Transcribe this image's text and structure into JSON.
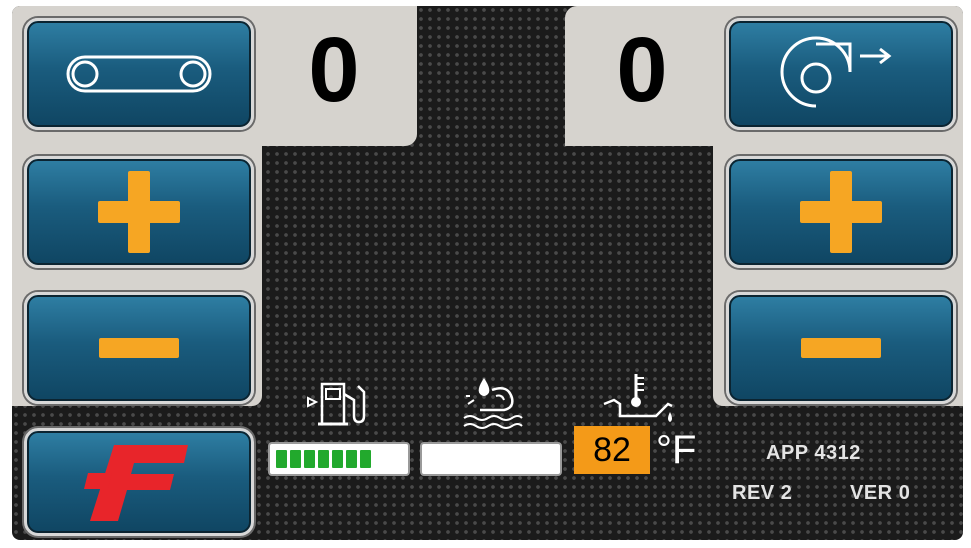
{
  "left": {
    "counter": "0",
    "buttons": {
      "plus_icon": "plus-icon",
      "minus_icon": "minus-icon",
      "top_icon": "conveyor-belt-icon",
      "logo": "brand-f-logo"
    }
  },
  "right": {
    "counter": "0",
    "buttons": {
      "plus_icon": "plus-icon",
      "minus_icon": "minus-icon",
      "top_icon": "blower-fan-icon"
    }
  },
  "gauges": {
    "fuel": {
      "icon": "fuel-pump-icon",
      "segments_lit": 7,
      "color": "#22a92d"
    },
    "water": {
      "icon": "water-contamination-icon",
      "level": 0
    },
    "oil_temp": {
      "icon": "oil-temperature-icon",
      "value": "82",
      "unit": "°F",
      "box_color": "#f49a18"
    }
  },
  "info": {
    "app_label": "APP",
    "app_value": "4312",
    "rev_label": "REV",
    "rev_value": "2",
    "ver_label": "VER",
    "ver_value": "0"
  },
  "colors": {
    "accent": "#f6a623",
    "button_blue": "#1a5c7e",
    "panel": "#d6d3ce",
    "logo_red": "#e8252a"
  }
}
